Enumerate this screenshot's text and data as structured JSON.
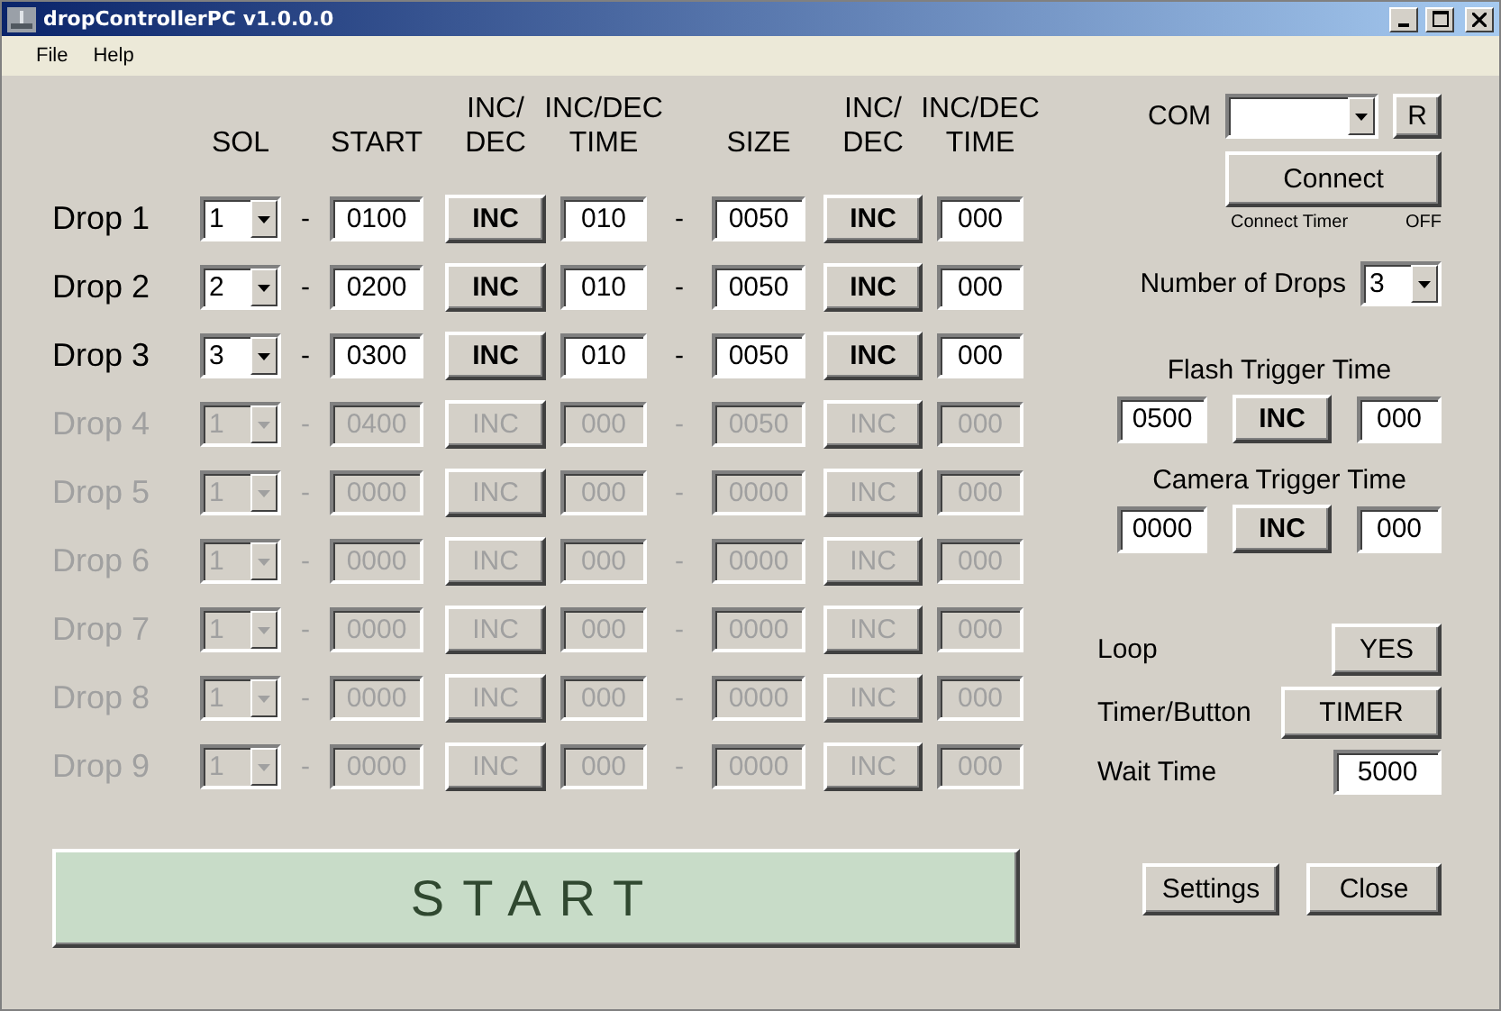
{
  "window": {
    "title": "dropControllerPC v1.0.0.0"
  },
  "menu": [
    "File",
    "Help"
  ],
  "headers": [
    {
      "lines": [
        "SOL"
      ]
    },
    {
      "lines": [
        "START"
      ]
    },
    {
      "lines": [
        "INC/",
        "DEC"
      ]
    },
    {
      "lines": [
        "INC/DEC",
        "TIME"
      ]
    },
    {
      "lines": [
        "SIZE"
      ]
    },
    {
      "lines": [
        "INC/",
        "DEC"
      ]
    },
    {
      "lines": [
        "INC/DEC",
        "TIME"
      ]
    }
  ],
  "drops": [
    {
      "label": "Drop 1",
      "sol": "1",
      "dash": "-",
      "start": "0100",
      "start_mode": "INC",
      "start_time": "010",
      "dash_2": "-",
      "size": "0050",
      "size_mode": "INC",
      "size_time": "000",
      "disabled": false
    },
    {
      "label": "Drop 2",
      "sol": "2",
      "dash": "-",
      "start": "0200",
      "start_mode": "INC",
      "start_time": "010",
      "dash_2": "-",
      "size": "0050",
      "size_mode": "INC",
      "size_time": "000",
      "disabled": false
    },
    {
      "label": "Drop 3",
      "sol": "3",
      "dash": "-",
      "start": "0300",
      "start_mode": "INC",
      "start_time": "010",
      "dash_2": "-",
      "size": "0050",
      "size_mode": "INC",
      "size_time": "000",
      "disabled": false
    },
    {
      "label": "Drop 4",
      "sol": "1",
      "dash": "-",
      "start": "0400",
      "start_mode": "INC",
      "start_time": "000",
      "dash_2": "-",
      "size": "0050",
      "size_mode": "INC",
      "size_time": "000",
      "disabled": true
    },
    {
      "label": "Drop 5",
      "sol": "1",
      "dash": "-",
      "start": "0000",
      "start_mode": "INC",
      "start_time": "000",
      "dash_2": "-",
      "size": "0000",
      "size_mode": "INC",
      "size_time": "000",
      "disabled": true
    },
    {
      "label": "Drop 6",
      "sol": "1",
      "dash": "-",
      "start": "0000",
      "start_mode": "INC",
      "start_time": "000",
      "dash_2": "-",
      "size": "0000",
      "size_mode": "INC",
      "size_time": "000",
      "disabled": true
    },
    {
      "label": "Drop 7",
      "sol": "1",
      "dash": "-",
      "start": "0000",
      "start_mode": "INC",
      "start_time": "000",
      "dash_2": "-",
      "size": "0000",
      "size_mode": "INC",
      "size_time": "000",
      "disabled": true
    },
    {
      "label": "Drop 8",
      "sol": "1",
      "dash": "-",
      "start": "0000",
      "start_mode": "INC",
      "start_time": "000",
      "dash_2": "-",
      "size": "0000",
      "size_mode": "INC",
      "size_time": "000",
      "disabled": true
    },
    {
      "label": "Drop 9",
      "sol": "1",
      "dash": "-",
      "start": "0000",
      "start_mode": "INC",
      "start_time": "000",
      "dash_2": "-",
      "size": "0000",
      "size_mode": "INC",
      "size_time": "000",
      "disabled": true
    }
  ],
  "start_button": "START",
  "connection": {
    "com_label": "COM",
    "refresh_button": "R",
    "connect_button": "Connect",
    "timer_label": "Connect Timer",
    "timer_status": "OFF"
  },
  "number_of_drops": {
    "label": "Number of Drops",
    "value": "3"
  },
  "triggers": [
    {
      "label": "Flash Trigger Time",
      "start": "0500",
      "mode": "INC",
      "time": "000"
    },
    {
      "label": "Camera Trigger Time",
      "start": "0000",
      "mode": "INC",
      "time": "000"
    }
  ],
  "options": [
    {
      "label": "Loop",
      "kind": "button",
      "value": "YES"
    },
    {
      "label": "Timer/Button",
      "kind": "button",
      "value": "TIMER"
    },
    {
      "label": "Wait Time",
      "kind": "field",
      "value": "5000"
    }
  ],
  "buttons": [
    "Settings",
    "Close"
  ]
}
